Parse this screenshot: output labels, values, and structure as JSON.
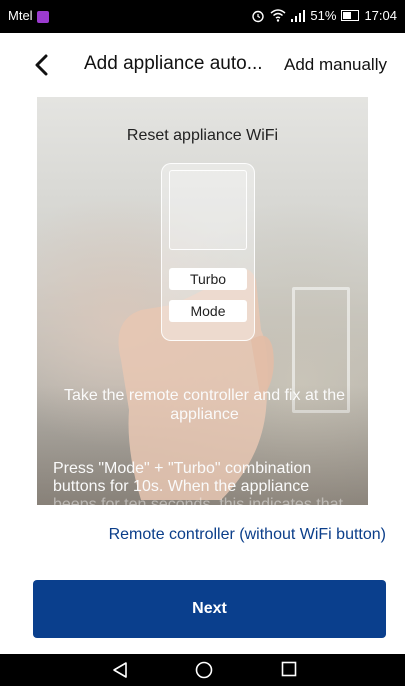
{
  "status_bar": {
    "carrier": "Mtel",
    "battery": "51%",
    "battery_level": 0.51,
    "time": "17:04"
  },
  "header": {
    "title": "Add appliance auto...",
    "action": "Add manually"
  },
  "instructions": {
    "heading": "Reset appliance WiFi",
    "remote_buttons": [
      "Turbo",
      "Mode"
    ],
    "step1": "Take the remote controller and fix at the appliance",
    "step2_line1": "Press \"Mode\" + \"Turbo\" combination",
    "step2_line2": "buttons for 10s. When the appliance",
    "step2_line3_partial": "beeps for ten seconds, this indicates that"
  },
  "link": "Remote controller (without WiFi button)",
  "primary_button": "Next",
  "colors": {
    "accent": "#0a3f8d",
    "link": "#0b3e8a"
  },
  "icons": {
    "back": "chevron-left-icon",
    "nav_back": "triangle-back-icon",
    "nav_home": "circle-home-icon",
    "nav_recent": "square-recent-icon"
  }
}
